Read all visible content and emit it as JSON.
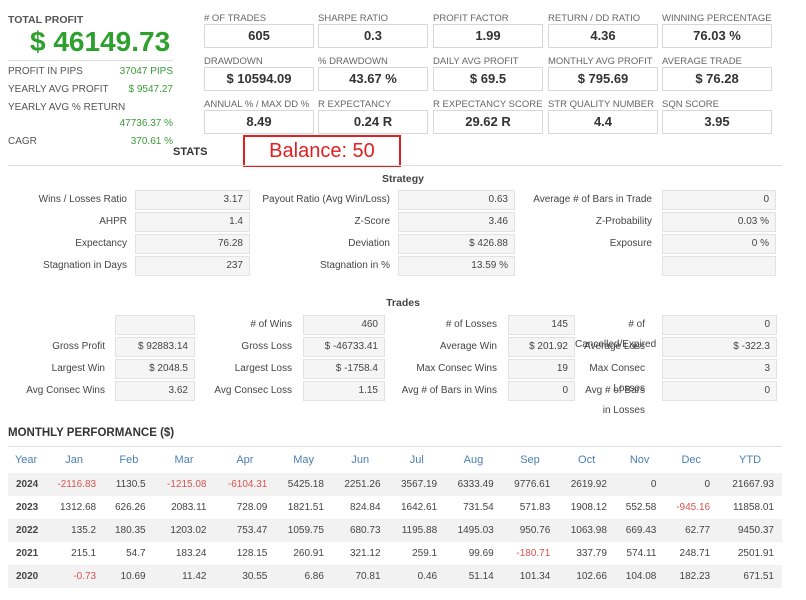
{
  "summary": {
    "title": "TOTAL PROFIT",
    "total": "$ 46149.73",
    "items": [
      {
        "label": "PROFIT IN PIPS",
        "value": "37047 PIPS"
      },
      {
        "label": "YEARLY AVG PROFIT",
        "value": "$ 9547.27"
      },
      {
        "label": "YEARLY AVG % RETURN",
        "value": "47736.37 %"
      },
      {
        "label": "CAGR",
        "value": "370.61 %"
      }
    ]
  },
  "cards": [
    {
      "label": "# OF TRADES",
      "value": "605"
    },
    {
      "label": "SHARPE RATIO",
      "value": "0.3"
    },
    {
      "label": "PROFIT FACTOR",
      "value": "1.99"
    },
    {
      "label": "RETURN / DD RATIO",
      "value": "4.36"
    },
    {
      "label": "WINNING PERCENTAGE",
      "value": "76.03 %"
    },
    {
      "label": "DRAWDOWN",
      "value": "$ 10594.09"
    },
    {
      "label": "% DRAWDOWN",
      "value": "43.67 %"
    },
    {
      "label": "DAILY AVG PROFIT",
      "value": "$ 69.5"
    },
    {
      "label": "MONTHLY AVG PROFIT",
      "value": "$ 795.69"
    },
    {
      "label": "AVERAGE TRADE",
      "value": "$ 76.28"
    },
    {
      "label": "ANNUAL % / MAX DD %",
      "value": "8.49"
    },
    {
      "label": "R EXPECTANCY",
      "value": "0.24 R"
    },
    {
      "label": "R EXPECTANCY SCORE",
      "value": "29.62 R"
    },
    {
      "label": "STR QUALITY NUMBER",
      "value": "4.4"
    },
    {
      "label": "SQN SCORE",
      "value": "3.95"
    }
  ],
  "stats_title": "STATS",
  "annotation": "Balance:  50",
  "accent": "#2ea02e",
  "negative": "#d9534f",
  "annotation_color": "#e02020",
  "strategy": {
    "title": "Strategy",
    "rows": [
      [
        {
          "label": "Wins / Losses Ratio",
          "value": "3.17"
        },
        {
          "label": "Payout Ratio (Avg Win/Loss)",
          "value": "0.63"
        },
        {
          "label": "Average # of Bars in Trade",
          "value": "0"
        }
      ],
      [
        {
          "label": "AHPR",
          "value": "1.4"
        },
        {
          "label": "Z-Score",
          "value": "3.46"
        },
        {
          "label": "Z-Probability",
          "value": "0.03 %"
        }
      ],
      [
        {
          "label": "Expectancy",
          "value": "76.28"
        },
        {
          "label": "Deviation",
          "value": "$ 426.88"
        },
        {
          "label": "Exposure",
          "value": "0 %"
        }
      ],
      [
        {
          "label": "Stagnation in Days",
          "value": "237"
        },
        {
          "label": "Stagnation in %",
          "value": "13.59 %"
        },
        {
          "label": "",
          "value": ""
        }
      ]
    ]
  },
  "trades": {
    "title": "Trades",
    "rows": [
      [
        {
          "label": "",
          "value": ""
        },
        {
          "label": "# of Wins",
          "value": "460"
        },
        {
          "label": "# of Losses",
          "value": "145"
        },
        {
          "label": "# of Cancelled/Expired",
          "value": "0"
        }
      ],
      [
        {
          "label": "Gross Profit",
          "value": "$ 92883.14"
        },
        {
          "label": "Gross Loss",
          "value": "$ -46733.41"
        },
        {
          "label": "Average Win",
          "value": "$ 201.92"
        },
        {
          "label": "Average Loss",
          "value": "$ -322.3"
        }
      ],
      [
        {
          "label": "Largest Win",
          "value": "$ 2048.5"
        },
        {
          "label": "Largest Loss",
          "value": "$ -1758.4"
        },
        {
          "label": "Max Consec Wins",
          "value": "19"
        },
        {
          "label": "Max Consec Losses",
          "value": "3"
        }
      ],
      [
        {
          "label": "Avg Consec Wins",
          "value": "3.62"
        },
        {
          "label": "Avg Consec Loss",
          "value": "1.15"
        },
        {
          "label": "Avg # of Bars in Wins",
          "value": "0"
        },
        {
          "label": "Avg # of Bars in Losses",
          "value": "0"
        }
      ]
    ]
  },
  "monthly": {
    "title": "MONTHLY PERFORMANCE ($)",
    "headers": [
      "Year",
      "Jan",
      "Feb",
      "Mar",
      "Apr",
      "May",
      "Jun",
      "Jul",
      "Aug",
      "Sep",
      "Oct",
      "Nov",
      "Dec",
      "YTD"
    ],
    "rows": [
      [
        "2024",
        "-2116.83",
        "1130.5",
        "-1215.08",
        "-6104.31",
        "5425.18",
        "2251.26",
        "3567.19",
        "6333.49",
        "9776.61",
        "2619.92",
        "0",
        "0",
        "21667.93"
      ],
      [
        "2023",
        "1312.68",
        "626.26",
        "2083.11",
        "728.09",
        "1821.51",
        "824.84",
        "1642.61",
        "731.54",
        "571.83",
        "1908.12",
        "552.58",
        "-945.16",
        "11858.01"
      ],
      [
        "2022",
        "135.2",
        "180.35",
        "1203.02",
        "753.47",
        "1059.75",
        "680.73",
        "1195.88",
        "1495.03",
        "950.76",
        "1063.98",
        "669.43",
        "62.77",
        "9450.37"
      ],
      [
        "2021",
        "215.1",
        "54.7",
        "183.24",
        "128.15",
        "260.91",
        "321.12",
        "259.1",
        "99.69",
        "-180.71",
        "337.79",
        "574.11",
        "248.71",
        "2501.91"
      ],
      [
        "2020",
        "-0.73",
        "10.69",
        "11.42",
        "30.55",
        "6.86",
        "70.81",
        "0.46",
        "51.14",
        "101.34",
        "102.66",
        "104.08",
        "182.23",
        "671.51"
      ]
    ]
  }
}
